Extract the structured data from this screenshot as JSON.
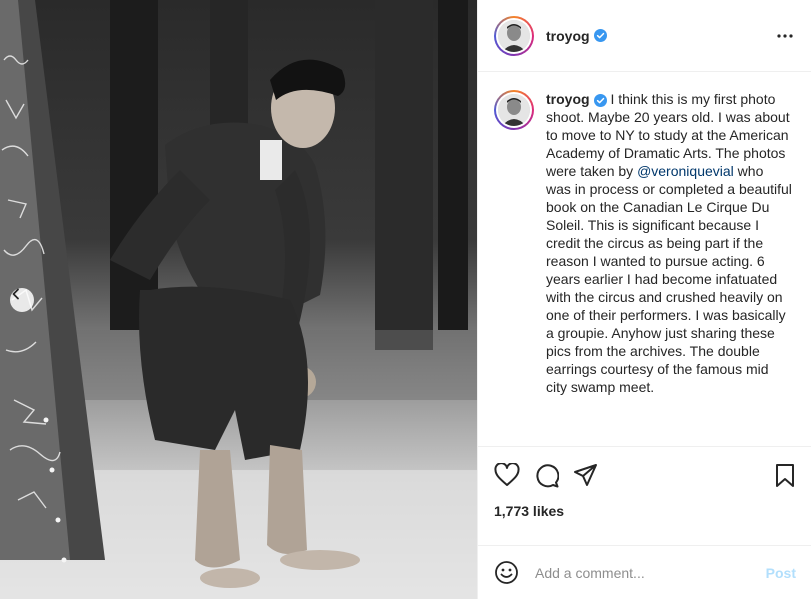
{
  "post": {
    "username": "troyog",
    "verified": true,
    "caption_segments": {
      "before_mention": "I think this is my first photo shoot. Maybe 20 years old. I was about to move to NY to study at the American Academy of Dramatic Arts. The photos were taken by ",
      "mention": "@veroniquevial",
      "after_mention": " who was in process or completed a beautiful book on the Canadian Le Cirque Du Soleil. This is significant because I credit the circus as being part if the reason I wanted to pursue acting. 6 years earlier I had become infatuated with the circus and crushed heavily on one of their performers. I was basically a groupie. Anyhow just sharing these pics from the archives. The double earrings courtesy of the famous mid city swamp meet."
    },
    "likes": "1,773 likes"
  },
  "comment": {
    "placeholder": "Add a comment...",
    "post_label": "Post"
  },
  "colors": {
    "verified_blue": "#3897f0",
    "mention_link": "#00376b",
    "post_button_disabled": "#b2dffc"
  },
  "icons": [
    "chevron-left-icon",
    "verified-icon",
    "more-options-icon",
    "heart-icon",
    "comment-icon",
    "share-icon",
    "bookmark-icon",
    "emoji-icon"
  ]
}
